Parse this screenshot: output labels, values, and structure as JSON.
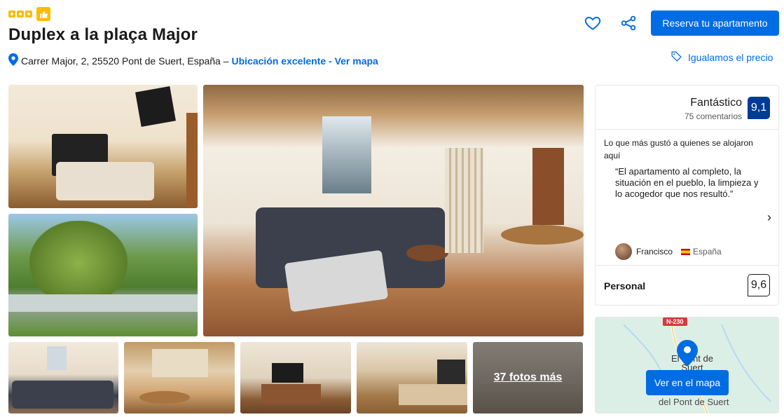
{
  "header": {
    "title": "Duplex a la plaça Major",
    "address": "Carrer Major, 2, 25520 Pont de Suert, España –",
    "location_link": "Ubicación excelente - Ver mapa",
    "reserve_label": "Reserva tu apartamento",
    "price_match_label": "Igualamos el precio",
    "star_count": 3
  },
  "gallery": {
    "more_photos_label": "37 fotos más"
  },
  "review": {
    "rating_label": "Fantástico",
    "review_count": "75 comentarios",
    "score": "9,1",
    "liked_title": "Lo que más gustó a quienes se alojaron aquí",
    "quote": "“El apartamento al completo, la situación en el pueblo, la limpieza y lo acogedor que nos resultó.”",
    "reviewer_name": "Francisco",
    "reviewer_country": "España",
    "category_label": "Personal",
    "category_score": "9,6"
  },
  "map": {
    "button_label": "Ver en el mapa",
    "road_label": "N-230",
    "town_label_line1": "El Pont de",
    "town_label_line2": "Suert",
    "place_label": "del Pont de Suert"
  },
  "colors": {
    "brand_blue": "#006ce4",
    "score_blue": "#003b95",
    "star_yellow": "#febb02"
  }
}
